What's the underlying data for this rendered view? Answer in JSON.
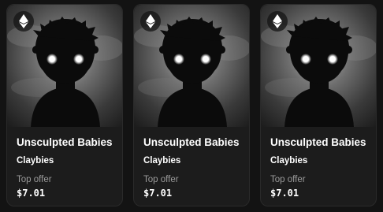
{
  "colors": {
    "background": "#131313",
    "card": "#1c1c1c",
    "text": "#ffffff",
    "muted": "#9b9b9b"
  },
  "cards": [
    {
      "image_icon": "shadow-child-artwork",
      "chain_icon": "ethereum-icon",
      "title": "Unsculpted Babies",
      "collection": "Claybies",
      "offer_label": "Top offer",
      "price": "$7.01"
    },
    {
      "image_icon": "shadow-child-artwork",
      "chain_icon": "ethereum-icon",
      "title": "Unsculpted Babies",
      "collection": "Claybies",
      "offer_label": "Top offer",
      "price": "$7.01"
    },
    {
      "image_icon": "shadow-child-artwork",
      "chain_icon": "ethereum-icon",
      "title": "Unsculpted Babies",
      "collection": "Claybies",
      "offer_label": "Top offer",
      "price": "$7.01"
    }
  ]
}
